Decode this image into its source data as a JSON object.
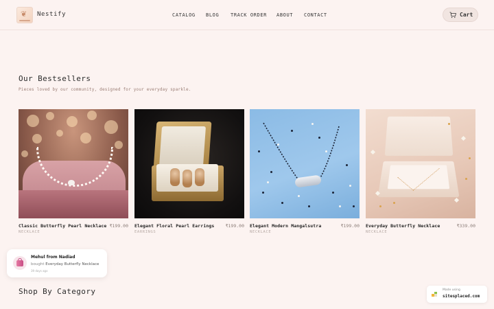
{
  "header": {
    "brand": "Nestify",
    "nav": [
      "CATALOG",
      "BLOG",
      "TRACK ORDER",
      "ABOUT",
      "CONTACT"
    ],
    "cart_label": "Cart"
  },
  "bestsellers": {
    "title": "Our Bestsellers",
    "subtitle": "Pieces loved by our community, designed for your everyday sparkle.",
    "products": [
      {
        "name": "Classic Butterfly Pearl Necklace",
        "price": "₹199.00",
        "category": "NECKLACE"
      },
      {
        "name": "Elegant Floral Pearl Earrings",
        "price": "₹199.00",
        "category": "EARRINGS"
      },
      {
        "name": "Elegant Modern Mangalsutra",
        "price": "₹199.00",
        "category": "NECKLACE"
      },
      {
        "name": "Everyday Butterfly Necklace",
        "price": "₹339.00",
        "category": "NECKLACE"
      }
    ]
  },
  "toast": {
    "title": "Mehul from Nadiad",
    "bought_word": "bought",
    "product": "Everyday Butterfly Necklace",
    "time": "39 days ago"
  },
  "shop_by_category": {
    "title": "Shop By Category"
  },
  "badge": {
    "line1": "Made using",
    "line2": "sitesplaced.com"
  },
  "colors": {
    "background": "#fcf3f1",
    "card_img_blue": "#8bbbe5",
    "accent_gold": "#c9a465"
  },
  "icons": {
    "cart": "cart-icon",
    "logo": "logo-icon",
    "badge": "sitesplaced-icon",
    "toast": "shopping-bag-icon"
  }
}
